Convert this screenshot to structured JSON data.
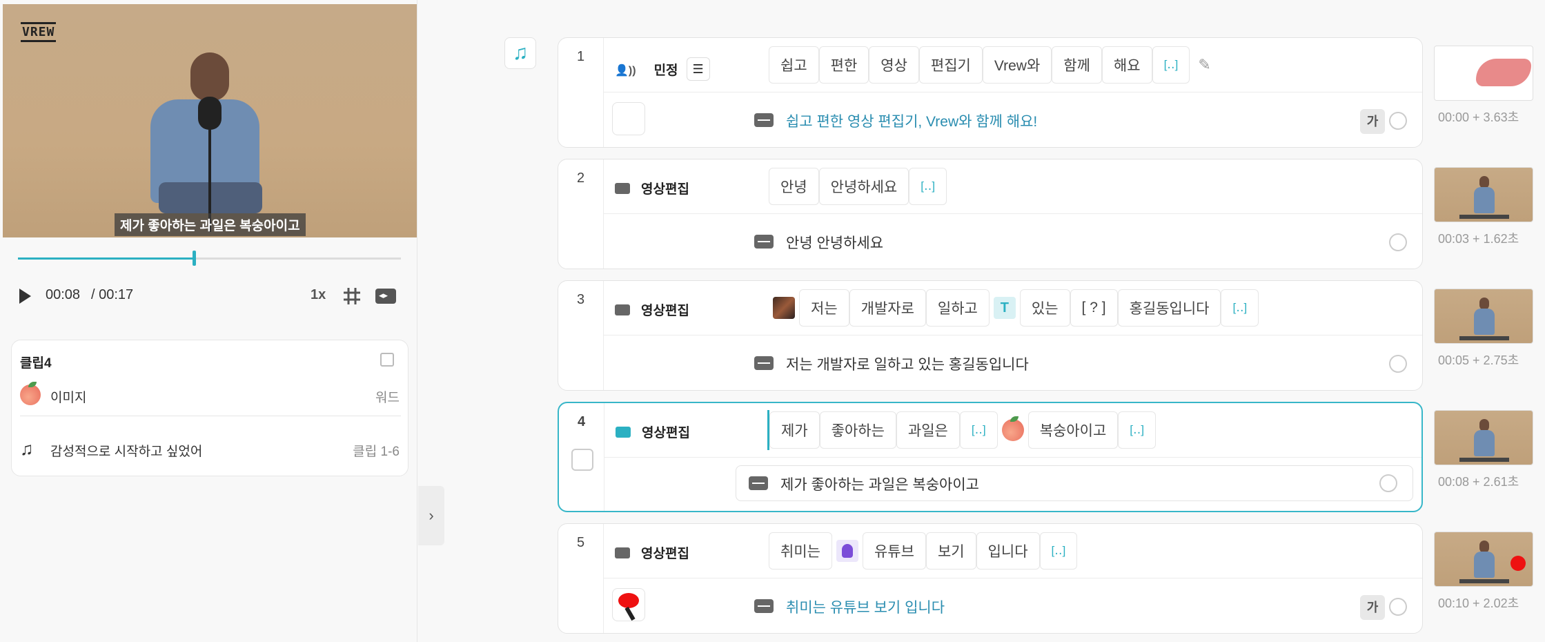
{
  "player": {
    "logo": "VREW",
    "overlay_subtitle": "제가 좋아하는 과일은 복숭아이고",
    "current_time": "00:08",
    "total_time": "/ 00:17",
    "progress": 0.46,
    "speed": "1x"
  },
  "clip_card": {
    "title": "클립4",
    "rows": [
      {
        "icon": "peach-icon",
        "label": "이미지",
        "meta": "워드"
      },
      {
        "icon": "music-note-icon",
        "label": "감성적으로 시작하고 싶었어",
        "meta": "클립 1-6"
      }
    ]
  },
  "accent_color": "#2bb0c2",
  "clips": [
    {
      "number": "1",
      "speaker": "민정",
      "words": [
        "쉽고",
        "편한",
        "영상",
        "편집기",
        "Vrew와",
        "함께",
        "해요",
        "[‥]"
      ],
      "subtitle": "쉽고 편한 영상 편집기, Vrew와 함께 해요!",
      "ga": "가",
      "thumb_time": "00:00 + 3.63초"
    },
    {
      "number": "2",
      "speaker": "영상편집",
      "words": [
        "안녕",
        "안녕하세요",
        "[‥]"
      ],
      "subtitle": "안녕 안녕하세요",
      "thumb_time": "00:03 + 1.62초"
    },
    {
      "number": "3",
      "speaker": "영상편집",
      "words": [
        "저는",
        "개발자로",
        "일하고",
        "있는",
        "[ ? ]",
        "홍길동입니다",
        "[‥]"
      ],
      "text_fx": "T",
      "subtitle": "저는 개발자로 일하고 있는 홍길동입니다",
      "thumb_time": "00:05 + 2.75초"
    },
    {
      "number": "4",
      "speaker": "영상편집",
      "words": [
        "제가",
        "좋아하는",
        "과일은",
        "[‥]",
        "복숭아이고",
        "[‥]"
      ],
      "subtitle": "제가 좋아하는 과일은 복숭아이고",
      "thumb_time": "00:08 + 2.61초"
    },
    {
      "number": "5",
      "speaker": "영상편집",
      "words": [
        "취미는",
        "유튜브",
        "보기",
        "입니다",
        "[‥]"
      ],
      "subtitle": "취미는 유튜브 보기 입니다",
      "ga": "가",
      "thumb_time": "00:10 + 2.02초"
    }
  ]
}
